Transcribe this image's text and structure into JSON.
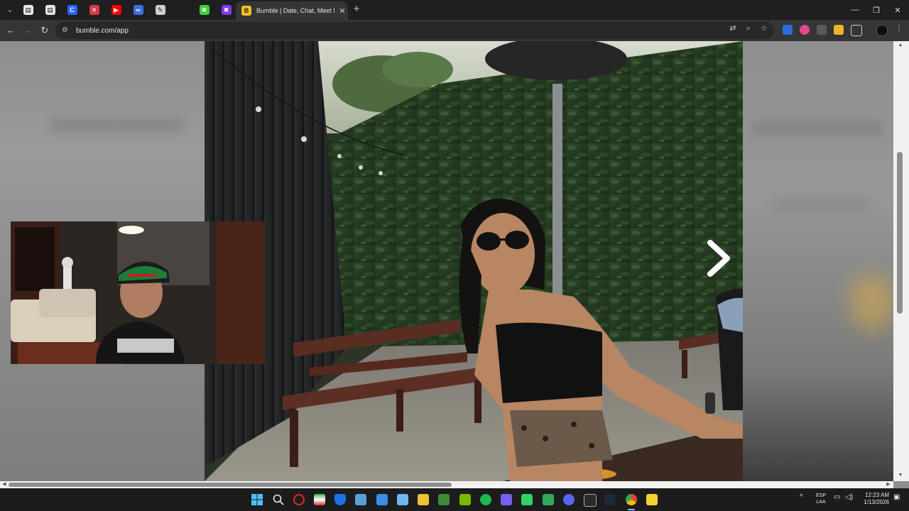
{
  "browser": {
    "active_tab": {
      "title": "Bumble | Date, Chat, Meet New"
    },
    "address_bar": {
      "url": "bumble.com/app"
    },
    "pinned_tabs": [
      {
        "icon": "generic-doc-icon",
        "color": "#e8e8e8",
        "glyph": "▤"
      },
      {
        "icon": "generic-doc-icon",
        "color": "#e8e8e8",
        "glyph": "▤"
      },
      {
        "icon": "c-app-icon",
        "color": "#2b64ff",
        "glyph": "C"
      },
      {
        "icon": "red-app-icon",
        "color": "#d9384a",
        "glyph": "✕"
      },
      {
        "icon": "youtube-icon",
        "color": "#ff0000",
        "glyph": "▶"
      },
      {
        "icon": "meta-icon",
        "color": "#3b6fe0",
        "glyph": "∞"
      },
      {
        "icon": "tool-icon",
        "color": "#cfcfcf",
        "glyph": "✎"
      },
      {
        "icon": "blank-tab-icon",
        "color": "#1f1f1f",
        "glyph": ""
      },
      {
        "icon": "green-x-icon",
        "color": "#3ad33a",
        "glyph": "✖"
      },
      {
        "icon": "purple-x-icon",
        "color": "#7d3cf0",
        "glyph": "✖"
      }
    ]
  },
  "taskbar": {
    "language": {
      "line1": "ESP",
      "line2": "LAA"
    },
    "clock": {
      "time": "12:23 AM",
      "date": "1/13/2026"
    }
  }
}
